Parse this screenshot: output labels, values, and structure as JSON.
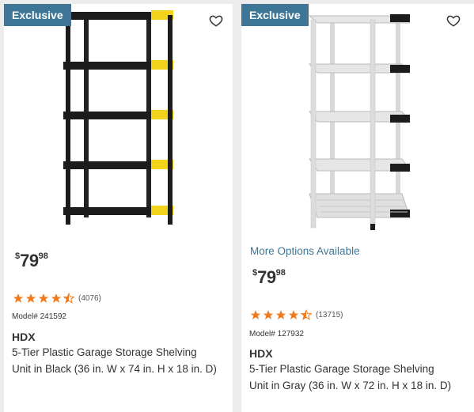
{
  "products": [
    {
      "badge": "Exclusive",
      "price_currency": "$",
      "price_dollars": "79",
      "price_cents": "98",
      "rating_count": "(4076)",
      "model": "Model# 241592",
      "brand": "HDX",
      "title_line1": "5-Tier Plastic Garage Storage Shelving",
      "title_line2": "Unit in Black (36 in. W x 74 in. H x 18 in. D)",
      "rating": 4.5,
      "shelf_color": "#1c1c1c",
      "accent_color": "#f2d31b"
    },
    {
      "badge": "Exclusive",
      "options_text": "More Options Available",
      "price_currency": "$",
      "price_dollars": "79",
      "price_cents": "98",
      "rating_count": "(13715)",
      "model": "Model# 127932",
      "brand": "HDX",
      "title_line1": "5-Tier Plastic Garage Storage Shelving",
      "title_line2": "Unit in Gray (36 in. W x 72 in. H x 18 in. D)",
      "rating": 4.5,
      "shelf_color": "#e4e4e4",
      "accent_color": "#1c1c1c"
    }
  ],
  "colors": {
    "badge_bg": "#3e7697",
    "star": "#f07b1f",
    "link": "#3e7697"
  }
}
